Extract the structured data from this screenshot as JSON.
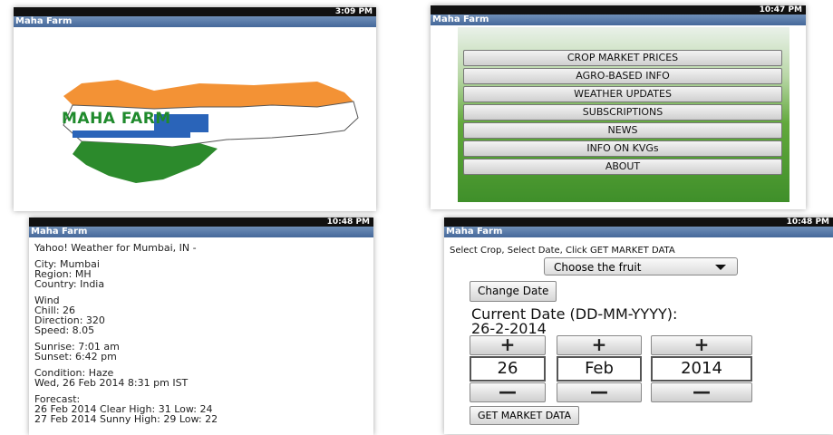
{
  "panel1": {
    "status": "3:09 PM",
    "title": "Maha Farm",
    "logo_text": "MAHA FARM",
    "colors": {
      "saffron": "#f39235",
      "green": "#2c8a2c",
      "blue": "#2a64b9"
    }
  },
  "panel2": {
    "status": "10:47 PM",
    "title": "Maha Farm",
    "menu": [
      "CROP MARKET PRICES",
      "AGRO-BASED INFO",
      "WEATHER UPDATES",
      "SUBSCRIPTIONS",
      "NEWS",
      "INFO ON KVGs",
      "ABOUT"
    ]
  },
  "panel3": {
    "status": "10:48 PM",
    "title": "Maha Farm",
    "heading": "Yahoo! Weather for Mumbai, IN -",
    "city": "City: Mumbai",
    "region": "Region: MH",
    "country": "Country: India",
    "wind": "Wind",
    "chill": "Chill: 26",
    "direction": "Direction: 320",
    "speed": "Speed: 8.05",
    "sunrise": "Sunrise: 7:01 am",
    "sunset": "Sunset: 6:42 pm",
    "condition": "Condition: Haze",
    "date": "Wed, 26 Feb 2014 8:31 pm IST",
    "forecast": "Forecast:",
    "fc1": "26 Feb 2014 Clear High: 31 Low: 24",
    "fc2": "27 Feb 2014 Sunny High: 29 Low: 22"
  },
  "panel4": {
    "status": "10:48 PM",
    "title": "Maha Farm",
    "instruction": "Select Crop, Select Date, Click GET MARKET DATA",
    "fruit_placeholder": "Choose the fruit",
    "change_date": "Change Date",
    "current_date_label": "Current Date (DD-MM-YYYY):",
    "current_date_value": "26-2-2014",
    "plus": "+",
    "minus": "—",
    "day": "26",
    "month": "Feb",
    "year": "2014",
    "get_market": "GET MARKET DATA"
  }
}
